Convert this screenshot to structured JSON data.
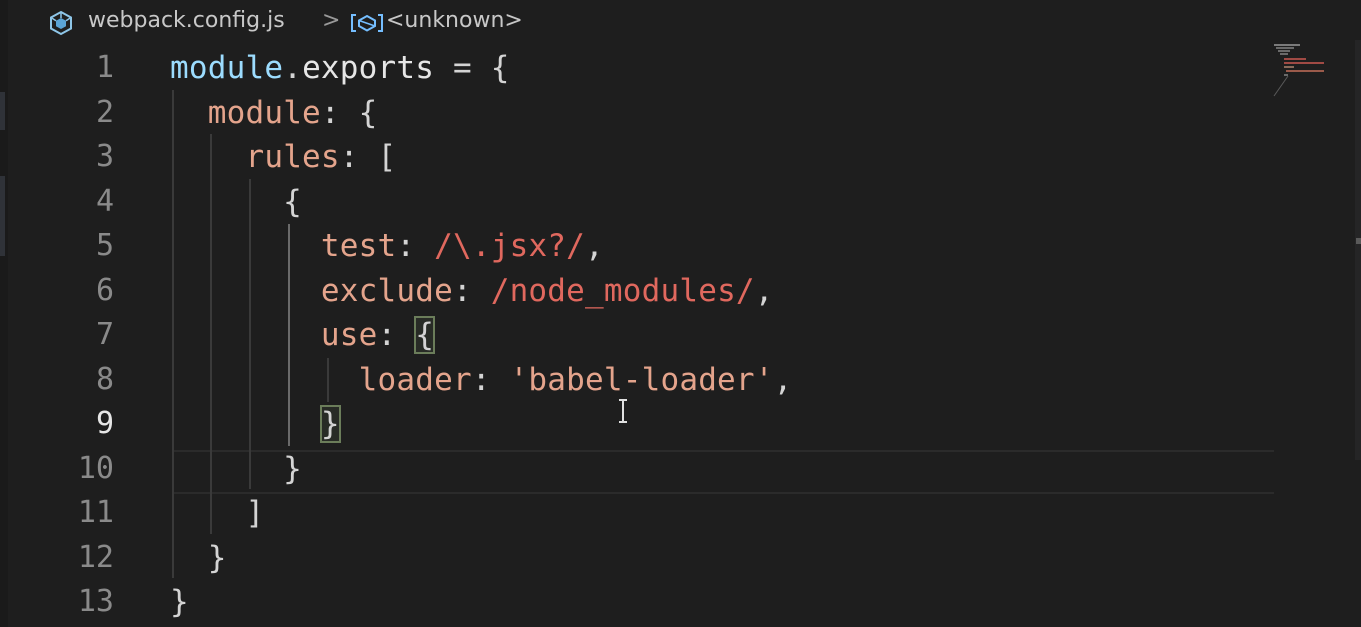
{
  "breadcrumb": {
    "file_icon": "webpack-cube-icon",
    "file": "webpack.config.js",
    "separator": ">",
    "symbol_icon": "symbol-object-icon",
    "symbol": "<unknown>"
  },
  "editor": {
    "active_line": 9,
    "lines": [
      {
        "number": "1",
        "tokens": [
          [
            "module",
            "ident"
          ],
          [
            ".",
            "punc"
          ],
          [
            "exports",
            "exports"
          ],
          [
            " = {",
            "punc"
          ]
        ]
      },
      {
        "number": "2",
        "tokens": [
          [
            "  ",
            "punc"
          ],
          [
            "module",
            "prop"
          ],
          [
            ": {",
            "punc"
          ]
        ]
      },
      {
        "number": "3",
        "tokens": [
          [
            "    ",
            "punc"
          ],
          [
            "rules",
            "prop"
          ],
          [
            ": [",
            "punc"
          ]
        ]
      },
      {
        "number": "4",
        "tokens": [
          [
            "      {",
            "punc"
          ]
        ]
      },
      {
        "number": "5",
        "tokens": [
          [
            "        ",
            "punc"
          ],
          [
            "test",
            "prop"
          ],
          [
            ": ",
            "punc"
          ],
          [
            "/\\.jsx?/",
            "regex"
          ],
          [
            ",",
            "punc"
          ]
        ]
      },
      {
        "number": "6",
        "tokens": [
          [
            "        ",
            "punc"
          ],
          [
            "exclude",
            "prop"
          ],
          [
            ": ",
            "punc"
          ],
          [
            "/node_modules/",
            "regex"
          ],
          [
            ",",
            "punc"
          ]
        ]
      },
      {
        "number": "7",
        "tokens": [
          [
            "        ",
            "punc"
          ],
          [
            "use",
            "prop"
          ],
          [
            ": ",
            "punc"
          ],
          [
            "{",
            "bracket"
          ]
        ]
      },
      {
        "number": "8",
        "tokens": [
          [
            "          ",
            "punc"
          ],
          [
            "loader",
            "prop"
          ],
          [
            ": ",
            "punc"
          ],
          [
            "'babel-loader'",
            "str"
          ],
          [
            ",",
            "punc"
          ]
        ]
      },
      {
        "number": "9",
        "tokens": [
          [
            "        ",
            "punc"
          ],
          [
            "}",
            "bracket"
          ]
        ]
      },
      {
        "number": "10",
        "tokens": [
          [
            "      }",
            "punc"
          ]
        ]
      },
      {
        "number": "11",
        "tokens": [
          [
            "    ]",
            "punc"
          ]
        ]
      },
      {
        "number": "12",
        "tokens": [
          [
            "  }",
            "punc"
          ]
        ]
      },
      {
        "number": "13",
        "tokens": [
          [
            "}",
            "punc"
          ]
        ]
      }
    ]
  },
  "colors": {
    "background": "#1e1e1e",
    "identifier": "#9cdcfe",
    "property": "#e4a48c",
    "regex": "#e0685e",
    "string": "#e4a48c"
  }
}
